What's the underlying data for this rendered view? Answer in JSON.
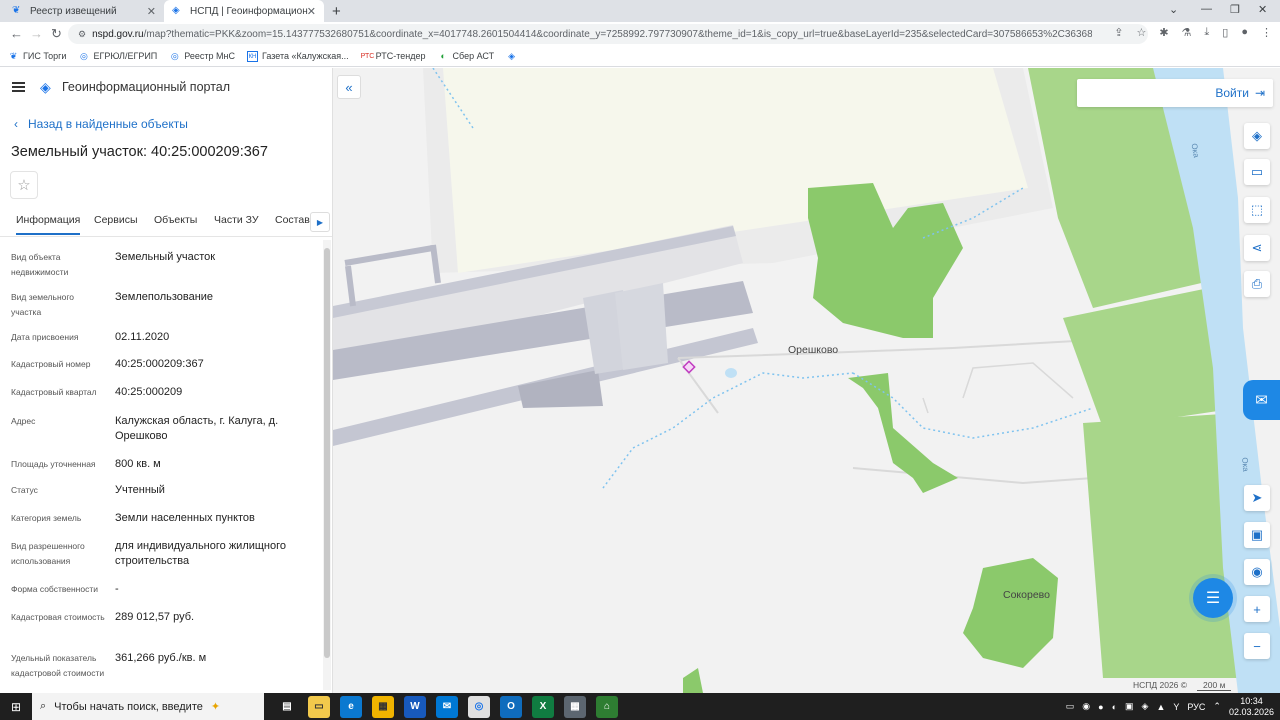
{
  "browser": {
    "tabs": [
      {
        "title": "Реестр извещений"
      },
      {
        "title": "НСПД | Геоинформационный п"
      }
    ],
    "url_host": "nspd.gov.ru",
    "url_rest": "/map?thematic=PKK&zoom=15.143777532680751&coordinate_x=4017748.2601504414&coordinate_y=7258992.797730907&theme_id=1&is_copy_url=true&baseLayerId=235&selectedCard=307586653%2C36368%2C40%3A25%3...",
    "bookmarks": [
      "ГИС Торги",
      "ЕГРЮЛ/ЕГРИП",
      "Реестр МнС",
      "Газета «Калужская...",
      "РТС-тендер",
      "Сбер АСТ"
    ]
  },
  "app": {
    "title": "Геоинформационный портал",
    "back_label": "Назад в найденные объекты",
    "object_title": "Земельный участок: 40:25:000209:367",
    "tabs": [
      "Информация",
      "Сервисы",
      "Объекты",
      "Части ЗУ",
      "Состав"
    ],
    "properties": [
      {
        "label": "Вид объекта недвижимости",
        "value": "Земельный участок"
      },
      {
        "label": "Вид земельного участка",
        "value": "Землепользование"
      },
      {
        "label": "Дата присвоения",
        "value": "02.11.2020"
      },
      {
        "label": "Кадастровый номер",
        "value": "40:25:000209:367"
      },
      {
        "label": "Кадастровый квартал",
        "value": "40:25:000209"
      },
      {
        "label": "Адрес",
        "value": "Калужская область, г. Калуга, д. Орешково"
      },
      {
        "label": "Площадь уточненная",
        "value": "800 кв. м"
      },
      {
        "label": "Статус",
        "value": "Учтенный"
      },
      {
        "label": "Категория земель",
        "value": "Земли населенных пунктов"
      },
      {
        "label": "Вид разрешенного использования",
        "value": "для индивидуального жилищного строительства"
      },
      {
        "label": "Форма собственности",
        "value": "-"
      },
      {
        "label": "Кадастровая стоимость",
        "value": "289 012,57 руб."
      },
      {
        "label": "Удельный показатель кадастровой стоимости",
        "value": "361,266 руб./кв. м"
      }
    ]
  },
  "map": {
    "login_label": "Войти",
    "labels": {
      "village1": "Орешково",
      "village2": "Сокорево",
      "river1": "Ока",
      "river2": "Ока"
    },
    "copyright": "НСПД 2026 ©",
    "scale": "200 м",
    "colors": {
      "forest": "#8bc96b",
      "field": "#a8d68a",
      "river": "#bfe0f5",
      "highlight": "#c03cc0"
    }
  },
  "taskbar": {
    "search_placeholder": "Чтобы начать поиск, введите",
    "lang": "РУС",
    "time": "10:34",
    "date": "02.03.2026"
  }
}
